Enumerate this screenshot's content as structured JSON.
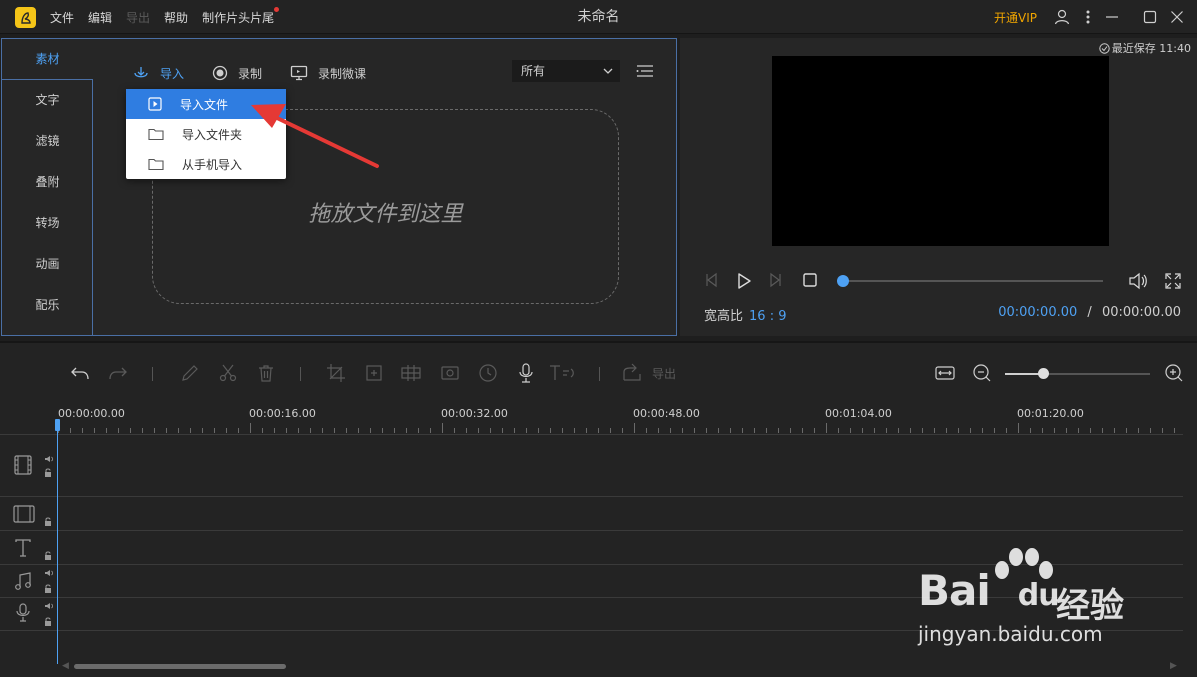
{
  "app": {
    "menu": [
      {
        "label": "文件",
        "enabled": true
      },
      {
        "label": "编辑",
        "enabled": true
      },
      {
        "label": "导出",
        "enabled": false
      },
      {
        "label": "帮助",
        "enabled": true
      },
      {
        "label": "制作片头片尾",
        "enabled": true,
        "badge": "red-dot"
      }
    ],
    "title": "未命名",
    "vip_label": "开通VIP",
    "window_buttons": [
      "user-icon",
      "more-vert-icon",
      "minimize-icon",
      "maximize-icon",
      "close-icon"
    ]
  },
  "media": {
    "tabs": [
      "素材",
      "文字",
      "滤镜",
      "叠附",
      "转场",
      "动画",
      "配乐"
    ],
    "active_tab": "素材",
    "toolbar": {
      "import_label": "导入",
      "record_label": "录制",
      "record_lecture_label": "录制微课",
      "filter_value": "所有"
    },
    "import_menu": [
      {
        "label": "导入文件",
        "icon": "play-file-icon",
        "highlighted": true
      },
      {
        "label": "导入文件夹",
        "icon": "folder-icon",
        "highlighted": false
      },
      {
        "label": "从手机导入",
        "icon": "folder-icon",
        "highlighted": false
      }
    ],
    "drop_text": "拖放文件到这里"
  },
  "preview": {
    "save_note": "最近保存 11:40",
    "ratio_label": "宽高比",
    "ratio_value": "16 : 9",
    "current_time": "00:00:00.00",
    "time_separator": "/",
    "total_time": "00:00:00.00",
    "progress": 0
  },
  "timeline": {
    "export_label": "导出",
    "zoom_level": 0.26,
    "ruler_labels": [
      "00:00:00.00",
      "00:00:16.00",
      "00:00:32.00",
      "00:00:48.00",
      "00:01:04.00",
      "00:01:20.00"
    ],
    "tracks": [
      "video",
      "overlay",
      "text",
      "music",
      "voice"
    ]
  },
  "watermark": {
    "brand": "Bai",
    "brand_du": "du",
    "cn": "经验",
    "url": "jingyan.baidu.com"
  },
  "colors": {
    "accent": "#4ea1f3",
    "highlight": "#2f7de1",
    "vip": "#f0a500",
    "annotation_arrow": "#e53935"
  }
}
